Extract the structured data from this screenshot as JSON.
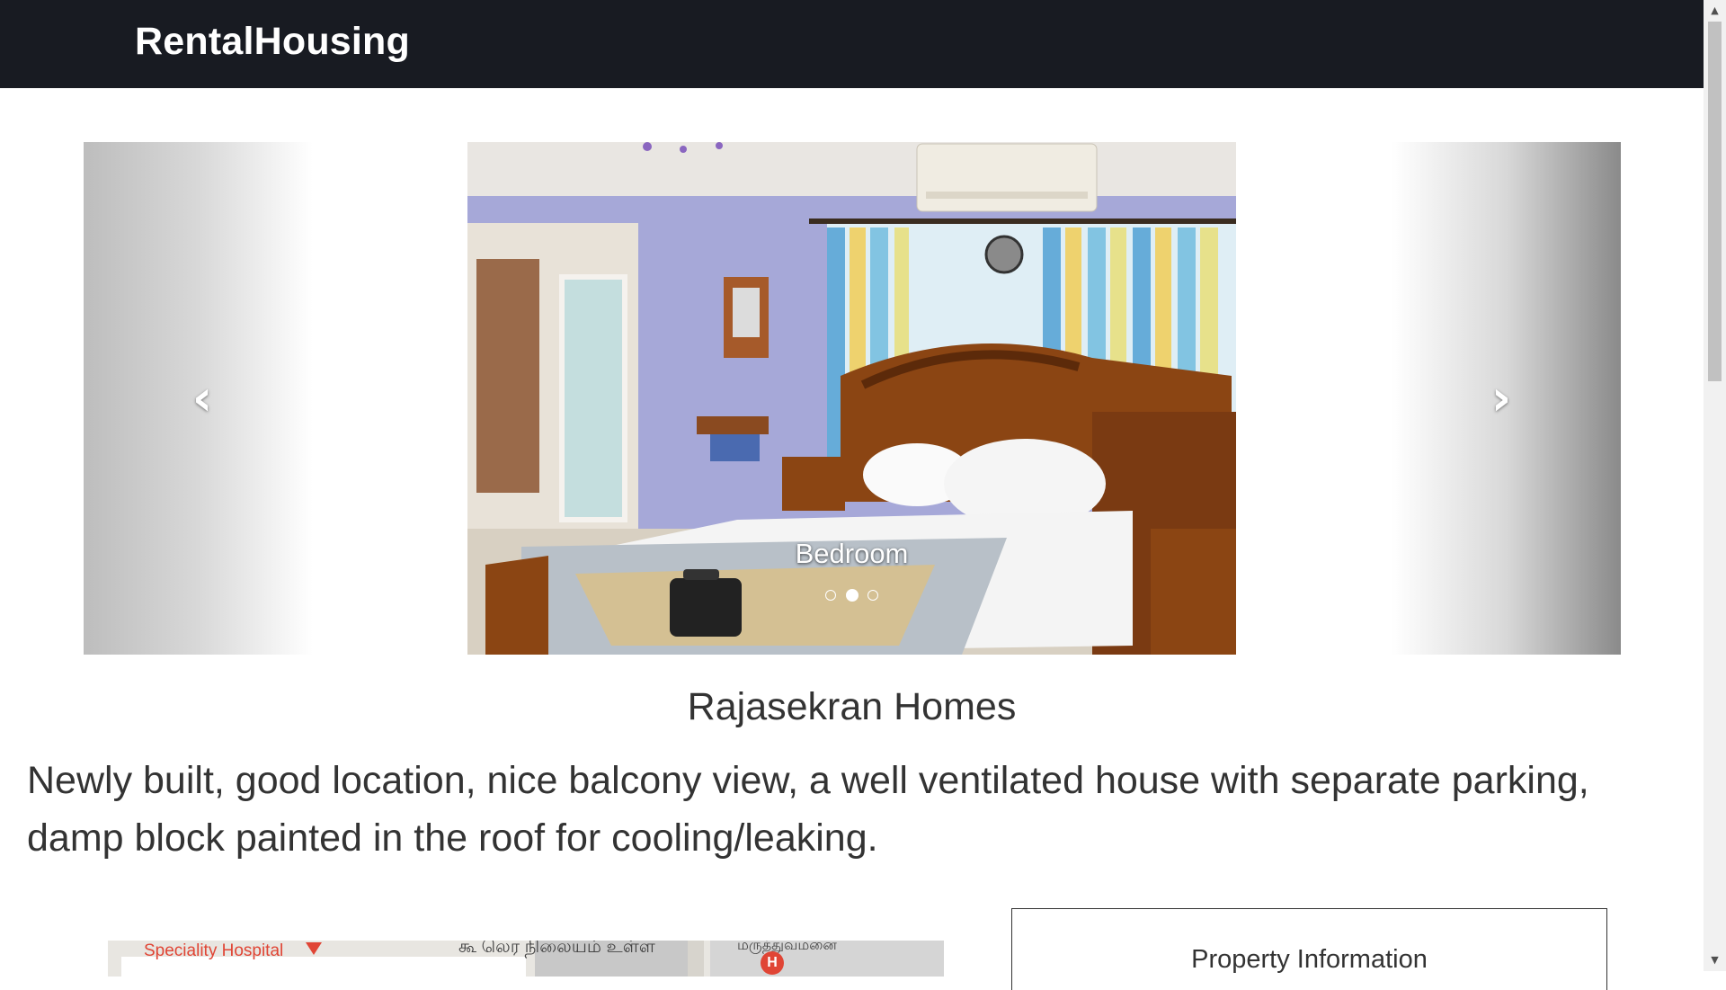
{
  "navbar": {
    "brand": "RentalHousing"
  },
  "carousel": {
    "prev_icon": "chevron-left-icon",
    "next_icon": "chevron-right-icon",
    "active_slide": {
      "caption": "Bedroom"
    },
    "indicator_count": 3,
    "active_index": 1
  },
  "property": {
    "title": "Rajasekran Homes",
    "description": "Newly built, good location, nice balcony view, a well ventilated house with separate parking, damp block painted in the roof for cooling/leaking."
  },
  "map": {
    "label_hospital": "Speciality Hospital",
    "label_tamil": "கூ லெர நிலையம் உள்ள",
    "label_tamil2": "மருத்துவமனை",
    "hospital_marker": "H"
  },
  "info": {
    "title": "Property Information"
  },
  "colors": {
    "navbar_bg": "#181b22",
    "brand_text": "#ffffff",
    "body_text": "#333333"
  }
}
